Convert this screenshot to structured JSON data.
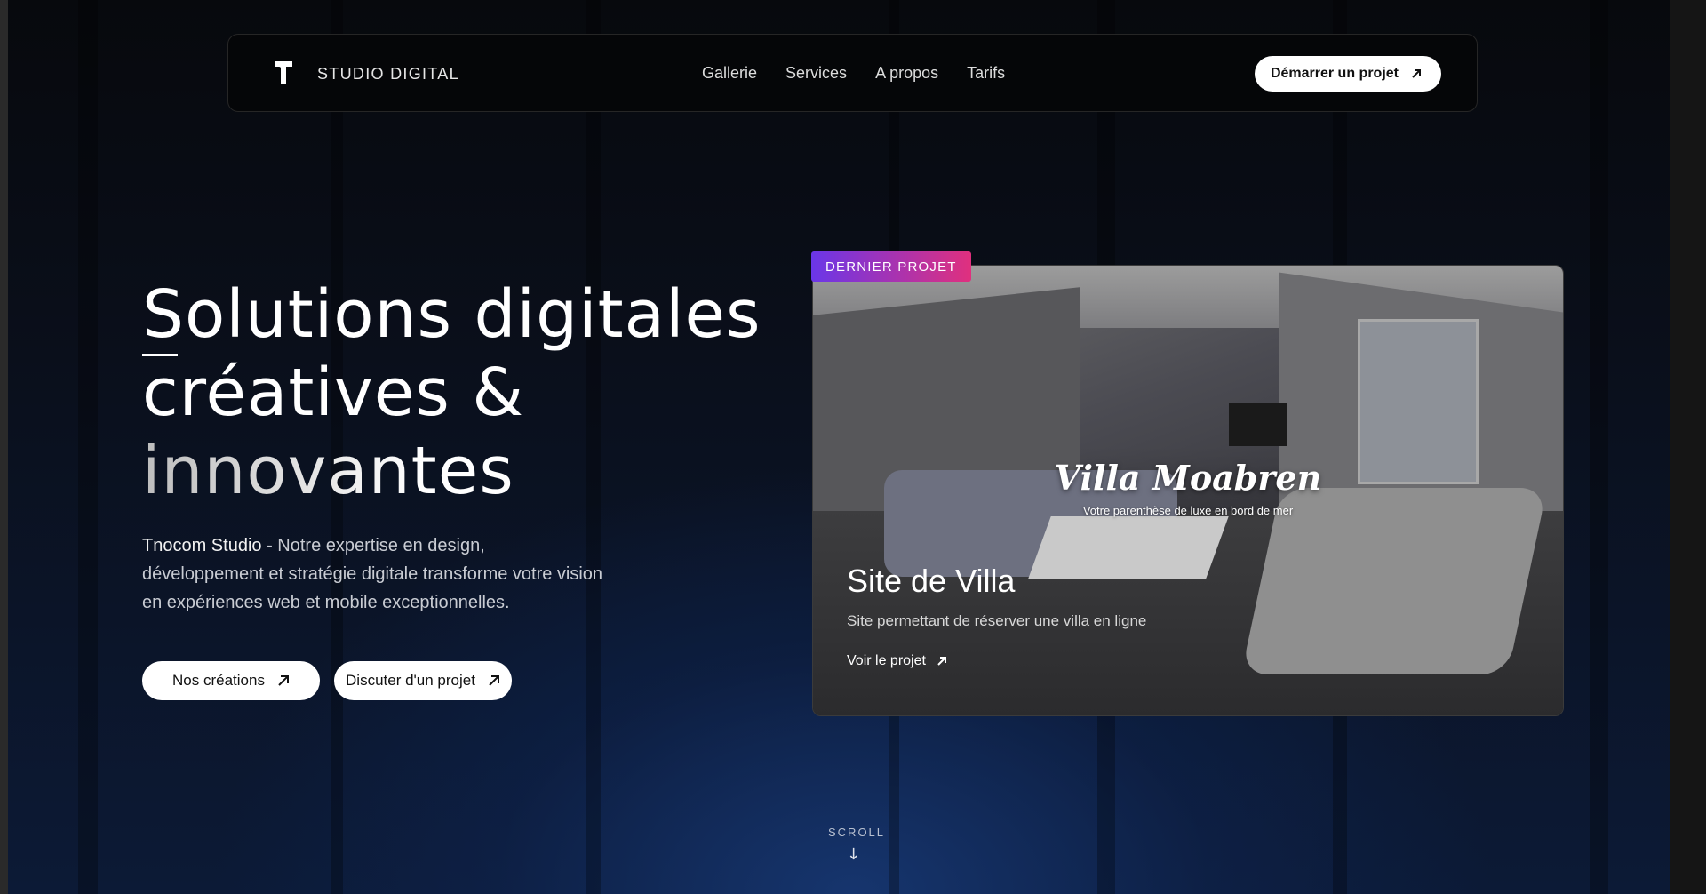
{
  "nav": {
    "brand": "STUDIO DIGITAL",
    "links": [
      "Gallerie",
      "Services",
      "A propos",
      "Tarifs"
    ],
    "cta_label": "Démarrer un projet",
    "cta_icon": "arrow-up-right-icon"
  },
  "hero": {
    "title_line1": "Solutions digitales",
    "title_line2": "créatives &",
    "title_line3": "innovantes",
    "studio_name": "Tnocom Studio",
    "description": " - Notre expertise en design, développement et stratégie digitale transforme votre vision en expériences web et mobile exceptionnelles.",
    "button_primary": "Nos créations",
    "button_secondary": "Discuter d'un projet"
  },
  "project": {
    "badge": "DERNIER PROJET",
    "image_title": "Villa Moabren",
    "image_subtitle": "Votre parenthèse de luxe en bord de mer",
    "title": "Site de Villa",
    "description": "Site permettant de réserver une villa en ligne",
    "link_label": "Voir le projet"
  },
  "scroll": {
    "label": "SCROLL",
    "arrow": "↓"
  },
  "colors": {
    "accent_gradient_start": "#6a36e8",
    "accent_gradient_end": "#e0307e",
    "background": "#07090d",
    "glow": "#16356e"
  }
}
